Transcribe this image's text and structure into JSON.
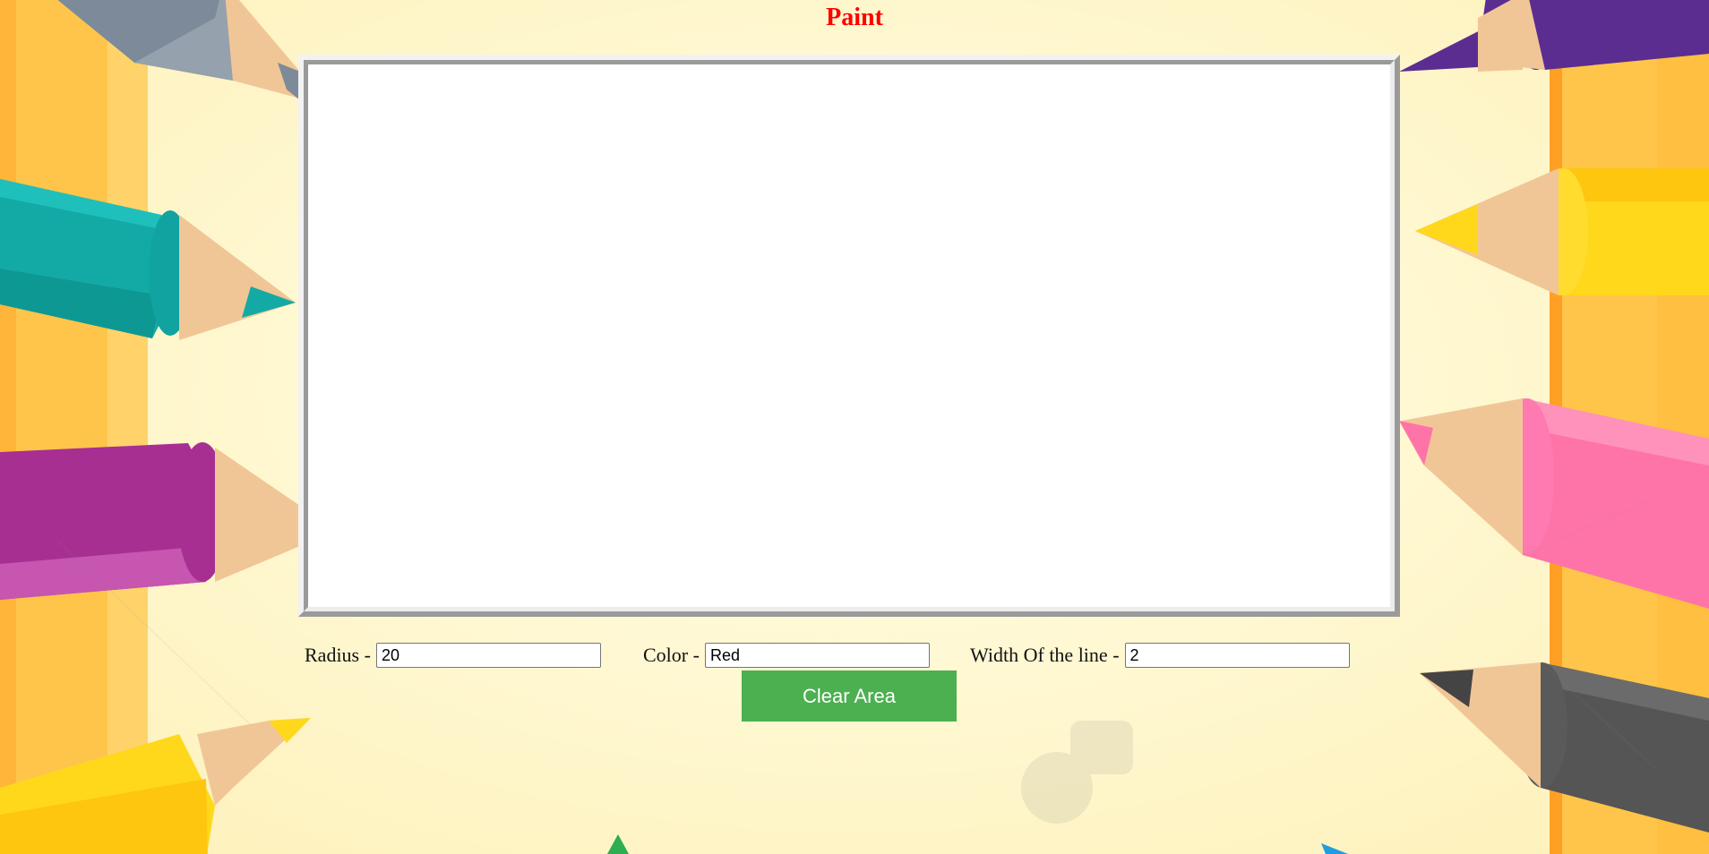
{
  "page": {
    "title": "Paint"
  },
  "controls": {
    "radius": {
      "label": "Radius -",
      "value": "20"
    },
    "color": {
      "label": "Color -",
      "value": "Red"
    },
    "line_width": {
      "label": "Width Of the line -",
      "value": "2"
    }
  },
  "clear_button": {
    "label": "Clear Area"
  },
  "colors": {
    "title": "#ff0000",
    "button": "#4caf50",
    "button_text": "#ffffff",
    "canvas": "#ffffff"
  },
  "background": {
    "description_icon": "pencils-illustration"
  }
}
